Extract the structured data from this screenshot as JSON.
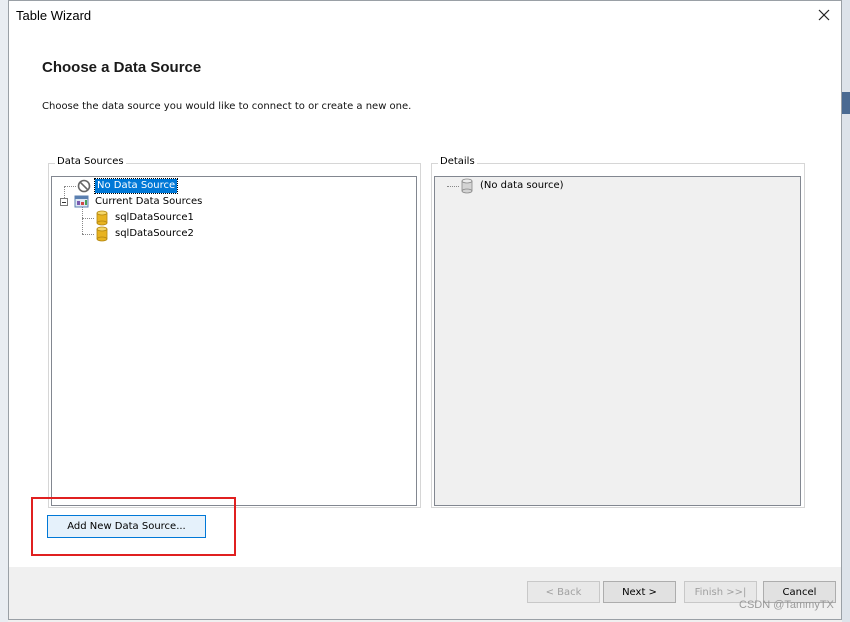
{
  "window": {
    "title": "Table Wizard"
  },
  "header": {
    "title": "Choose a Data Source",
    "description": "Choose the data source you would like to connect to or create a new one."
  },
  "data_sources": {
    "group_label": "Data Sources",
    "items": [
      {
        "label": "No Data Source",
        "icon": "no-data-icon",
        "selected": true
      },
      {
        "label": "Current Data Sources",
        "icon": "data-sources-folder-icon",
        "expanded": true
      },
      {
        "label": "sqlDataSource1",
        "icon": "database-icon"
      },
      {
        "label": "sqlDataSource2",
        "icon": "database-icon"
      }
    ]
  },
  "details": {
    "group_label": "Details",
    "items": [
      {
        "label": "(No data source)",
        "icon": "database-gray-icon"
      }
    ]
  },
  "buttons": {
    "add_new": "Add New Data Source...",
    "back": "< Back",
    "next": "Next >",
    "finish": "Finish >>|",
    "cancel": "Cancel"
  },
  "watermark": "CSDN @TammyTX",
  "colors": {
    "selection": "#0078d7",
    "highlight_box": "#e02020",
    "database_icon": "#e8b320"
  }
}
